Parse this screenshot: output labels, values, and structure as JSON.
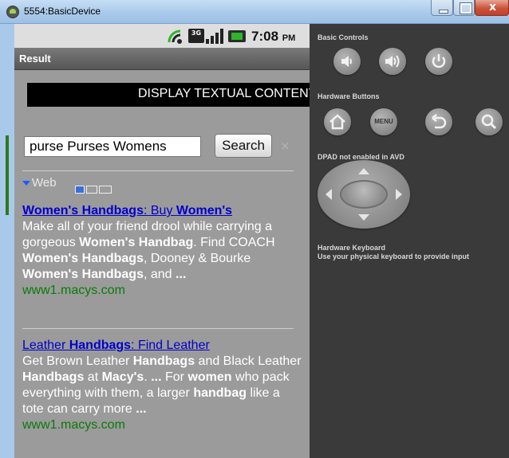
{
  "window": {
    "title": "5554:BasicDevice",
    "close_glyph": "x"
  },
  "statusbar": {
    "time": "7:08",
    "ampm": "PM",
    "network": "3G"
  },
  "app": {
    "title": "Result"
  },
  "banner": {
    "text": "DISPLAY TEXTUAL CONTENT"
  },
  "search": {
    "value": "purse   Purses Womens",
    "button_label": "Search",
    "clear_glyph": "×"
  },
  "web": {
    "label": "Web"
  },
  "results": [
    {
      "title_parts": [
        "Women's Handbags",
        ": Buy ",
        "Women's"
      ],
      "snippet_html_parts": [
        "Make all of your friend drool while carrying a gorgeous ",
        "Women's Handbag",
        ". Find COACH ",
        "Women's Handbags",
        ", Dooney & Bourke ",
        "Women's Handbags",
        ", and ",
        "..."
      ],
      "url": "www1.macys.com"
    },
    {
      "title_parts": [
        "Leather ",
        "Handbags",
        ": Find Leather"
      ],
      "snippet_html_parts": [
        "Get Brown Leather ",
        "Handbags",
        " and Black Leather ",
        "Handbags",
        " at ",
        "Macy's",
        ". ",
        "...",
        " For ",
        "women",
        " who pack everything with them, a larger ",
        "handbag",
        " like a tote can carry more ",
        "..."
      ],
      "url": "www1.macys.com"
    }
  ],
  "panel": {
    "basic_controls_label": "Basic Controls",
    "hardware_buttons_label": "Hardware Buttons",
    "menu_label": "MENU",
    "dpad_label": "DPAD not enabled in AVD",
    "keyboard_title": "Hardware Keyboard",
    "keyboard_hint": "Use your physical keyboard to provide input"
  },
  "icons": {
    "basic": [
      "volume-down-icon",
      "volume-up-icon",
      "power-icon"
    ],
    "hardware": [
      "home-icon",
      "menu-icon",
      "back-icon",
      "search-icon"
    ]
  }
}
